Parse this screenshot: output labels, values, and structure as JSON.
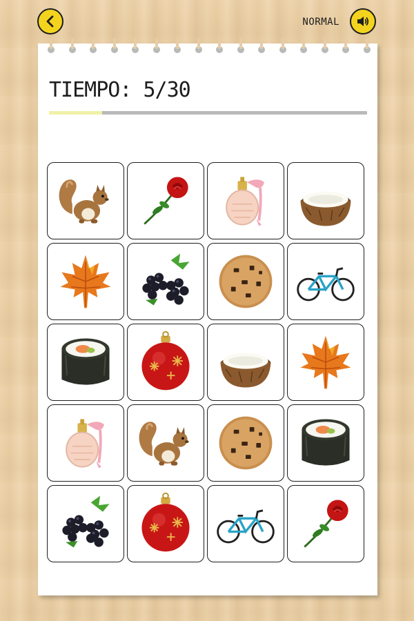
{
  "header": {
    "back_icon": "chevron-left-icon",
    "difficulty": "NORMAL",
    "sound_icon": "speaker-icon"
  },
  "timer": {
    "label": "TIEMPO: 5/30",
    "progress": 0.1667
  },
  "board": {
    "rows": 5,
    "cols": 4,
    "cards": [
      "squirrel",
      "rose",
      "perfume",
      "coconut",
      "maple-leaf",
      "blackberries",
      "cookie",
      "bicycle",
      "sushi",
      "ornament",
      "coconut",
      "maple-leaf",
      "perfume",
      "squirrel",
      "cookie",
      "sushi",
      "blackberries",
      "ornament",
      "bicycle",
      "rose"
    ]
  },
  "colors": {
    "accent": "#f4d31e",
    "progress_fill": "#f0f0a8",
    "progress_track": "#b9b9bb"
  }
}
